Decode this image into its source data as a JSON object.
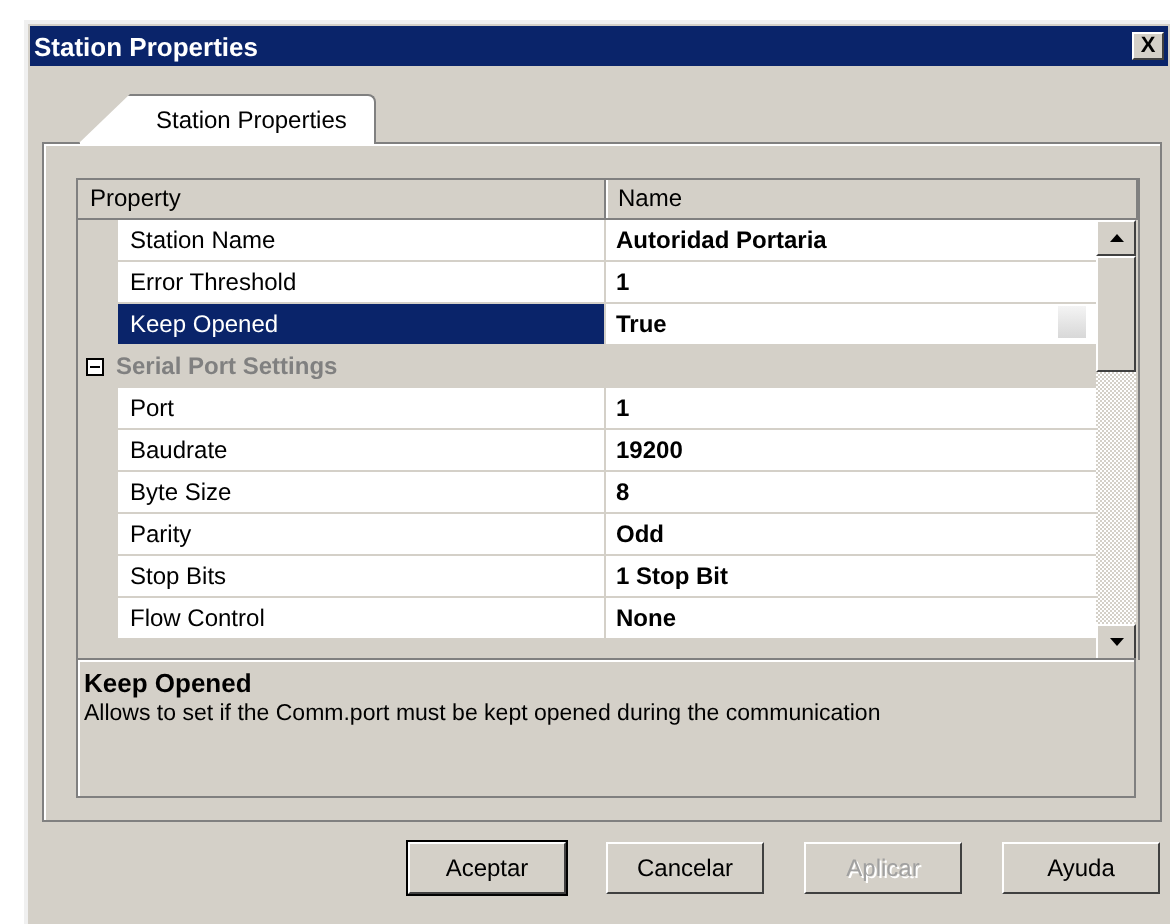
{
  "window": {
    "title": "Station Properties",
    "close": "X"
  },
  "tabs": [
    {
      "label": "Station Properties",
      "selected": true
    }
  ],
  "grid": {
    "columns": [
      "Property",
      "Name"
    ],
    "rows": [
      {
        "kind": "property",
        "label": "Station Name",
        "value": "Autoridad Portaria",
        "selected": false
      },
      {
        "kind": "property",
        "label": "Error Threshold",
        "value": "1",
        "selected": false
      },
      {
        "kind": "property",
        "label": "Keep Opened",
        "value": "True",
        "selected": true
      },
      {
        "kind": "category",
        "label": "Serial Port Settings",
        "expanded": true
      },
      {
        "kind": "property",
        "label": "Port",
        "value": "1",
        "selected": false
      },
      {
        "kind": "property",
        "label": "Baudrate",
        "value": "19200",
        "selected": false
      },
      {
        "kind": "property",
        "label": "Byte Size",
        "value": "8",
        "selected": false
      },
      {
        "kind": "property",
        "label": "Parity",
        "value": "Odd",
        "selected": false
      },
      {
        "kind": "property",
        "label": "Stop Bits",
        "value": "1 Stop Bit",
        "selected": false
      },
      {
        "kind": "property",
        "label": "Flow Control",
        "value": "None",
        "selected": false
      }
    ]
  },
  "description": {
    "title": "Keep Opened",
    "text": "Allows to set if the Comm.port must be kept opened during the communication"
  },
  "buttons": [
    {
      "label": "Aceptar",
      "default": true,
      "disabled": false
    },
    {
      "label": "Cancelar",
      "default": false,
      "disabled": false
    },
    {
      "label": "Aplicar",
      "default": false,
      "disabled": true
    },
    {
      "label": "Ayuda",
      "default": false,
      "disabled": false
    }
  ]
}
